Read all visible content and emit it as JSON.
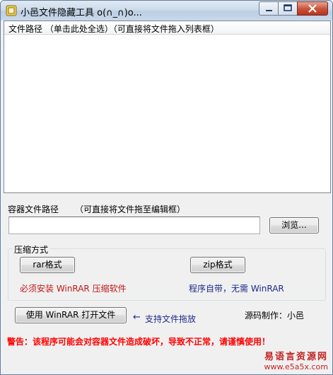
{
  "window": {
    "title": "小邑文件隐藏工具 o(∩_∩)o..."
  },
  "file_list": {
    "column_header": "文件路径  （单击此处全选）（可直接将文件拖入列表框）",
    "rows": []
  },
  "container": {
    "label": "容器文件路径",
    "hint": "（可直接将文件拖至编辑框）",
    "path_value": "",
    "browse_label": "浏览..."
  },
  "compression": {
    "group_title": "压缩方式",
    "rar_label": "rar格式",
    "zip_label": "zip格式",
    "rar_note": "必须安装 WinRAR 压缩软件",
    "zip_note": "程序自带，无需 WinRAR"
  },
  "open_button_label": "使用 WinRAR 打开文件",
  "drag_hint_arrow": "←",
  "drag_hint": "支持文件拖放",
  "author": "源码制作：小邑",
  "warning": "警告：该程序可能会对容器文件造成破坏，导致不正常，请谨慎使用！",
  "watermark": {
    "top": "易语言资源网",
    "bottom": "www.e5a5x.com"
  },
  "colors": {
    "red_note": "#c0181a",
    "blue_note": "#1b2a8c",
    "warning": "#ff0000"
  }
}
